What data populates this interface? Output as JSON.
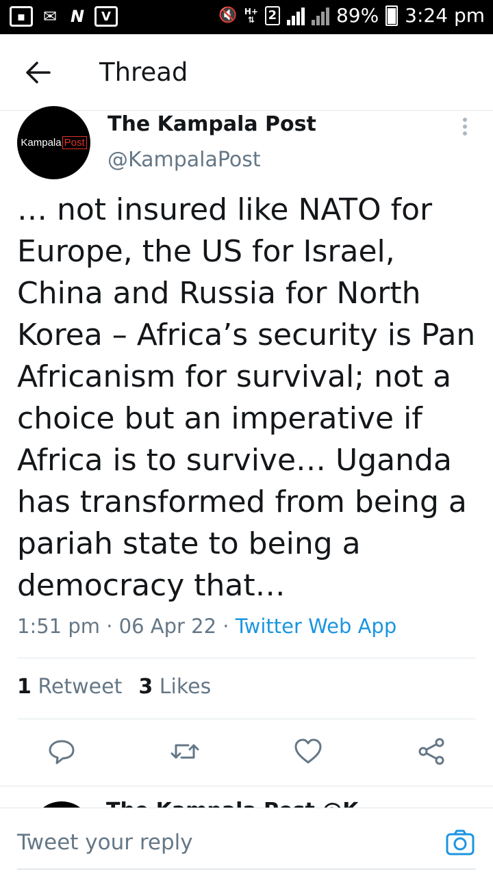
{
  "status_bar": {
    "battery": "89%",
    "time": "3:24 pm",
    "network_type": "H+",
    "sim_slot": "2"
  },
  "app_bar": {
    "title": "Thread",
    "icons": {
      "back": "arrow-left-icon"
    }
  },
  "tweet": {
    "avatar_label_main": "Kampala",
    "avatar_label_post": "Post",
    "author_name": "The Kampala Post",
    "handle": "@KampalaPost",
    "text": "… not insured like NATO for Europe, the US for Israel, China and Russia for North Korea – Africa’s security is Pan Africanism for survival; not a choice but an imperative if Africa is to survive… Uganda has transformed from being a pariah state to being a democracy that…",
    "time": "1:51 pm",
    "date": "06 Apr 22",
    "source": "Twitter Web App",
    "retweet_count": "1",
    "retweet_label": "Retweet",
    "like_count": "3",
    "like_label": "Likes"
  },
  "next_tweet_peek": {
    "text": "The Kampala Post @K"
  },
  "reply_bar": {
    "placeholder": "Tweet your reply"
  },
  "colors": {
    "link": "#1b95e0",
    "secondary_text": "#657786",
    "primary_text": "#14171a",
    "divider": "#e1e8ed",
    "brand_red": "#e0312b"
  }
}
